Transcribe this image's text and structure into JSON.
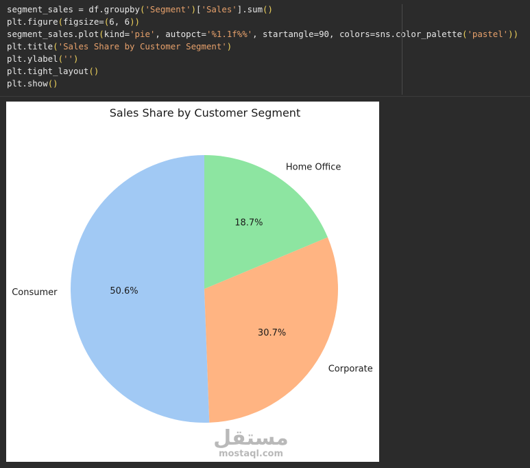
{
  "code_cell": {
    "lines": [
      [
        [
          "plain",
          "segment_sales = df.groupby"
        ],
        [
          "paren",
          "("
        ],
        [
          "str",
          "'Segment'"
        ],
        [
          "paren",
          ")"
        ],
        [
          "plain",
          "["
        ],
        [
          "str",
          "'Sales'"
        ],
        [
          "plain",
          "].sum"
        ],
        [
          "paren",
          "()"
        ]
      ],
      [
        [
          "plain",
          "plt.figure"
        ],
        [
          "paren",
          "("
        ],
        [
          "plain",
          "figsize="
        ],
        [
          "paren",
          "("
        ],
        [
          "plain",
          "6, 6"
        ],
        [
          "paren",
          "))"
        ]
      ],
      [
        [
          "plain",
          "segment_sales.plot"
        ],
        [
          "paren",
          "("
        ],
        [
          "plain",
          "kind="
        ],
        [
          "str",
          "'pie'"
        ],
        [
          "plain",
          ", autopct="
        ],
        [
          "str",
          "'%1.1f%%'"
        ],
        [
          "plain",
          ", startangle=90, colors=sns.color_palette"
        ],
        [
          "paren",
          "("
        ],
        [
          "str",
          "'pastel'"
        ],
        [
          "paren",
          "))"
        ]
      ],
      [
        [
          "plain",
          "plt.title"
        ],
        [
          "paren",
          "("
        ],
        [
          "str",
          "'Sales Share by Customer Segment'"
        ],
        [
          "paren",
          ")"
        ]
      ],
      [
        [
          "plain",
          "plt.ylabel"
        ],
        [
          "paren",
          "("
        ],
        [
          "str",
          "''"
        ],
        [
          "paren",
          ")"
        ]
      ],
      [
        [
          "plain",
          "plt.tight_layout"
        ],
        [
          "paren",
          "()"
        ]
      ],
      [
        [
          "plain",
          "plt.show"
        ],
        [
          "paren",
          "()"
        ]
      ]
    ]
  },
  "chart_data": {
    "type": "pie",
    "title": "Sales Share by Customer Segment",
    "start_angle_deg": 90,
    "direction": "counterclockwise",
    "slices": [
      {
        "label": "Consumer",
        "value": 50.6,
        "pct_label": "50.6%",
        "color": "#a1c9f4"
      },
      {
        "label": "Corporate",
        "value": 30.7,
        "pct_label": "30.7%",
        "color": "#ffb482"
      },
      {
        "label": "Home Office",
        "value": 18.7,
        "pct_label": "18.7%",
        "color": "#8de5a1"
      }
    ]
  },
  "watermark": {
    "arabic": "مستقل",
    "latin": "mostaql.com"
  }
}
